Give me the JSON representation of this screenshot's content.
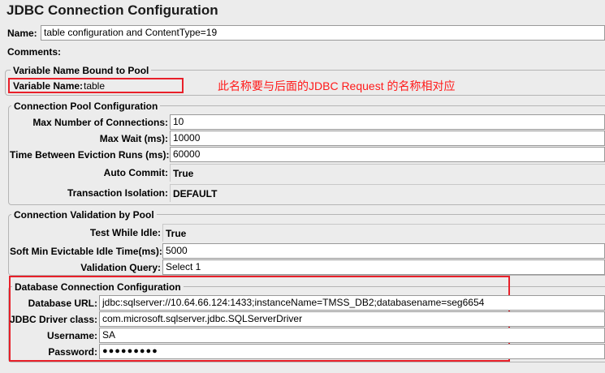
{
  "title": "JDBC Connection Configuration",
  "name": {
    "label": "Name:",
    "value": "table configuration and ContentType=19"
  },
  "comments": {
    "label": "Comments:"
  },
  "variable_section": {
    "legend": "Variable Name Bound to Pool",
    "label": "Variable Name:",
    "value": "table",
    "annotation": "此名称要与后面的JDBC Request 的名称相对应"
  },
  "pool_section": {
    "legend": "Connection Pool Configuration",
    "max_connections": {
      "label": "Max Number of Connections:",
      "value": "10"
    },
    "max_wait": {
      "label": "Max Wait (ms):",
      "value": "10000"
    },
    "eviction": {
      "label": "Time Between Eviction Runs (ms):",
      "value": "60000"
    },
    "auto_commit": {
      "label": "Auto Commit:",
      "value": "True"
    },
    "isolation": {
      "label": "Transaction Isolation:",
      "value": "DEFAULT"
    }
  },
  "validation_section": {
    "legend": "Connection Validation by Pool",
    "test_idle": {
      "label": "Test While Idle:",
      "value": "True"
    },
    "soft_min": {
      "label": "Soft Min Evictable Idle Time(ms):",
      "value": "5000"
    },
    "query": {
      "label": "Validation Query:",
      "value": "Select 1"
    }
  },
  "db_section": {
    "legend": "Database Connection Configuration",
    "url": {
      "label": "Database URL:",
      "value": "jdbc:sqlserver://10.64.66.124:1433;instanceName=TMSS_DB2;databasename=seg6654"
    },
    "driver": {
      "label": "JDBC Driver class:",
      "value": "com.microsoft.sqlserver.jdbc.SQLServerDriver"
    },
    "username": {
      "label": "Username:",
      "value": "SA"
    },
    "password": {
      "label": "Password:",
      "value": "●●●●●●●●●"
    }
  },
  "colors": {
    "highlight": "#e8202a",
    "annotation": "#ff1a1a"
  }
}
